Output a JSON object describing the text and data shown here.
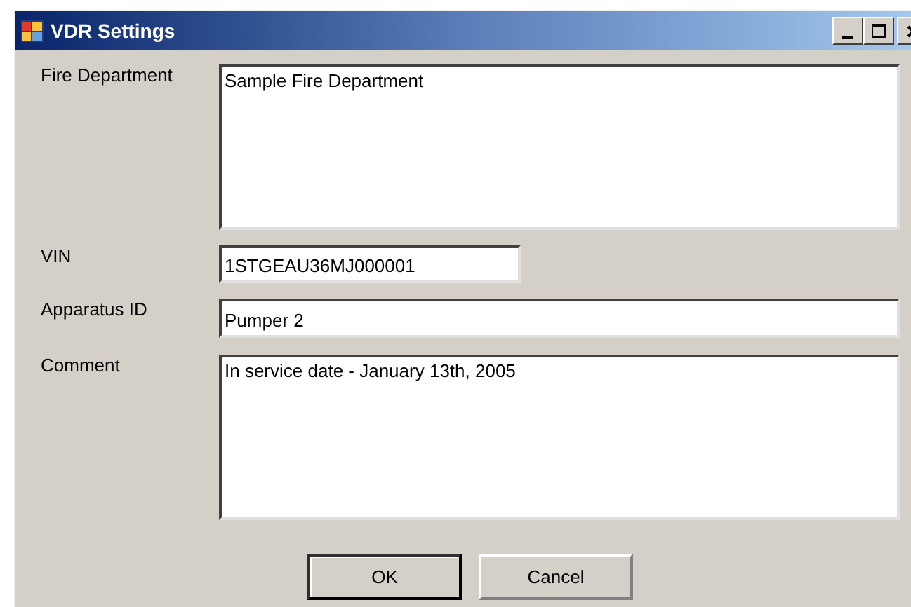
{
  "window": {
    "title": "VDR Settings"
  },
  "fields": [
    {
      "label": "Fire Department",
      "value": "Sample Fire Department",
      "kind": "multiline"
    },
    {
      "label": "VIN",
      "value": "1STGEAU36MJ000001",
      "kind": "short"
    },
    {
      "label": "Apparatus ID",
      "value": "Pumper 2",
      "kind": "line"
    },
    {
      "label": "Comment",
      "value": "In service date - January 13th, 2005",
      "kind": "multiline"
    }
  ],
  "buttons": [
    {
      "label": "OK",
      "default": true
    },
    {
      "label": "Cancel",
      "default": false
    }
  ]
}
